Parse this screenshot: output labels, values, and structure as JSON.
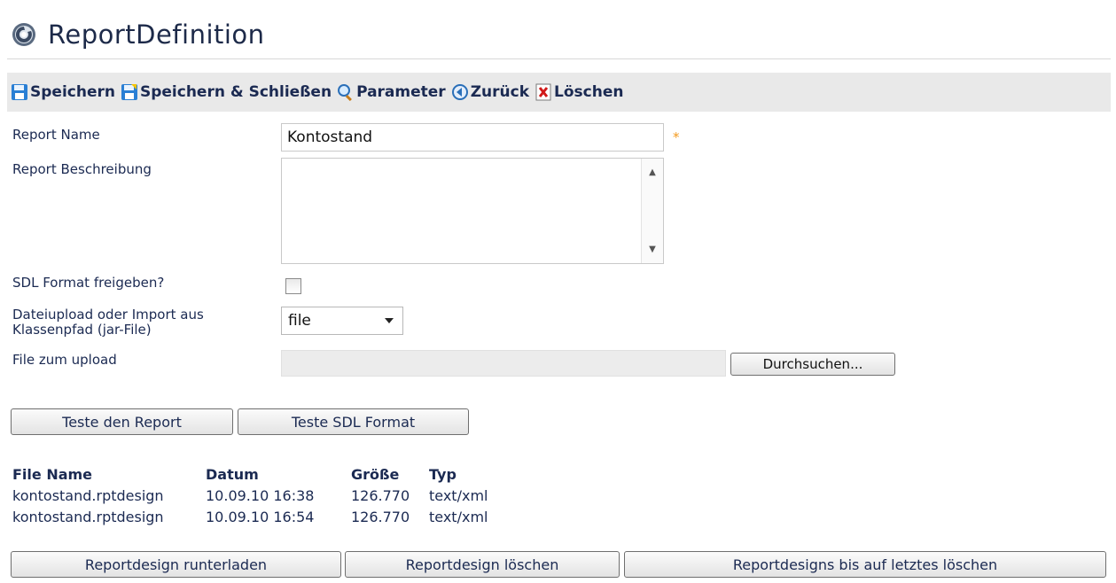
{
  "header": {
    "title": "ReportDefinition",
    "icon": "gear-globe-icon"
  },
  "toolbar": {
    "save": "Speichern",
    "save_close": "Speichern & Schließen",
    "parameters": "Parameter",
    "back": "Zurück",
    "delete": "Löschen"
  },
  "form": {
    "name_label": "Report Name",
    "name_value": "Kontostand",
    "required_marker": "*",
    "description_label": "Report Beschreibung",
    "description_value": "",
    "sdl_label": "SDL Format freigeben?",
    "sdl_checked": false,
    "upload_source_label_line1": "Dateiupload oder Import aus",
    "upload_source_label_line2": "Klassenpfad (jar-File)",
    "upload_source_value": "file",
    "file_label": "File zum upload",
    "file_value": "",
    "browse": "Durchsuchen..."
  },
  "test_buttons": {
    "test_report": "Teste den Report",
    "test_sdl": "Teste SDL Format"
  },
  "files": {
    "headers": [
      "File Name",
      "Datum",
      "Größe",
      "Typ"
    ],
    "rows": [
      [
        "kontostand.rptdesign",
        "10.09.10 16:38",
        "126.770",
        "text/xml"
      ],
      [
        "kontostand.rptdesign",
        "10.09.10 16:54",
        "126.770",
        "text/xml"
      ]
    ]
  },
  "bottom_buttons": {
    "download": "Reportdesign runterladen",
    "delete": "Reportdesign löschen",
    "delete_all_but_last": "Reportdesigns bis auf letztes löschen"
  },
  "colors": {
    "toolbar_bg": "#e9e9e9",
    "text": "#1b2a52",
    "required": "#f39a1e"
  }
}
